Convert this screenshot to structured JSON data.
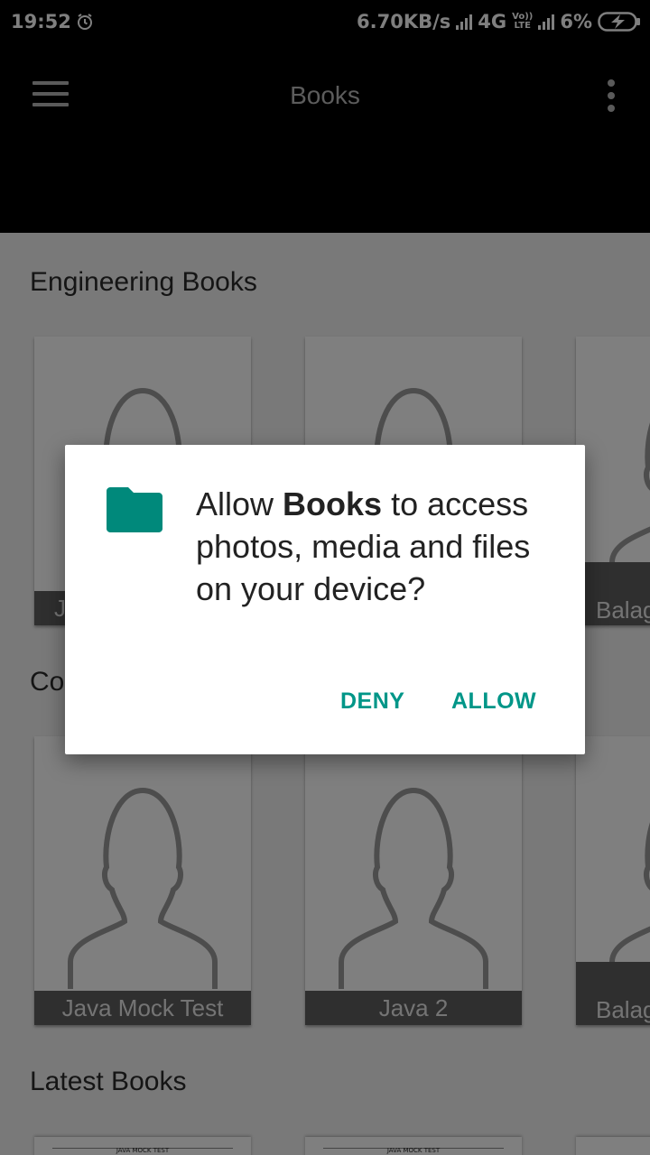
{
  "status_bar": {
    "time": "19:52",
    "net_speed": "6.70KB/s",
    "network": "4G",
    "volte_top": "Vo))",
    "volte_bottom": "LTE",
    "battery": "6%"
  },
  "toolbar": {
    "title": "Books"
  },
  "sections": [
    {
      "title": "Engineering Books",
      "items": [
        "J",
        "",
        "Balag"
      ]
    },
    {
      "title": "Co",
      "items": [
        "Java Mock Test",
        "Java 2",
        "Balag"
      ]
    },
    {
      "title": "Latest Books",
      "items": [
        "JAVA MOCK TEST",
        "JAVA MOCK TEST"
      ]
    }
  ],
  "dialog": {
    "message_pre": "Allow ",
    "app_name": "Books",
    "message_post": " to access photos, media and files on your device?",
    "deny_label": "DENY",
    "allow_label": "ALLOW",
    "accent_color": "#009688"
  }
}
